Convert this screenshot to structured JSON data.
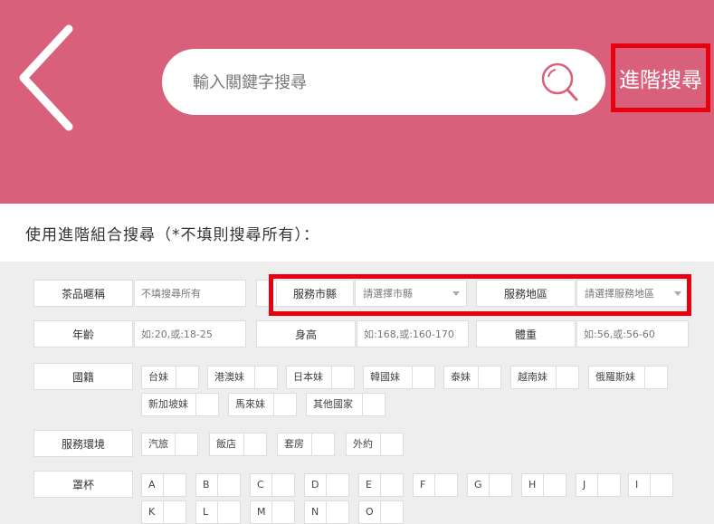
{
  "header": {
    "search_placeholder": "輸入關鍵字搜尋",
    "advanced_label": "進階搜尋"
  },
  "subheading": "使用進階組合搜尋（*不填則搜尋所有）：",
  "form": {
    "name_label": "茶品暱稱",
    "name_placeholder": "不填搜尋所有",
    "city_label": "服務市縣",
    "city_select": "請選擇市縣",
    "area_label": "服務地區",
    "area_select": "請選擇服務地區",
    "age_label": "年齡",
    "age_placeholder": "如:20,或:18-25",
    "height_label": "身高",
    "height_placeholder": "如:168,或:160-170",
    "weight_label": "體重",
    "weight_placeholder": "如:56,或:56-60",
    "nationality_label": "國籍",
    "nationalities": [
      "台妹",
      "港澳妹",
      "日本妹",
      "韓國妹",
      "泰妹",
      "越南妹",
      "俄羅斯妹",
      "新加坡妹",
      "馬來妹",
      "其他國家"
    ],
    "environment_label": "服務環境",
    "environments": [
      "汽旅",
      "飯店",
      "套房",
      "外約"
    ],
    "cup_label": "罩杯",
    "cups": [
      "A",
      "B",
      "C",
      "D",
      "E",
      "F",
      "G",
      "H",
      "J",
      "I",
      "K",
      "L",
      "M",
      "N",
      "O"
    ]
  },
  "colors": {
    "header_bg": "#d9607b",
    "highlight": "#e8000f",
    "form_bg": "#eeeeee"
  },
  "icons": {
    "back": "chevron-left-icon",
    "search": "search-icon",
    "dropdown": "caret-down-icon"
  }
}
